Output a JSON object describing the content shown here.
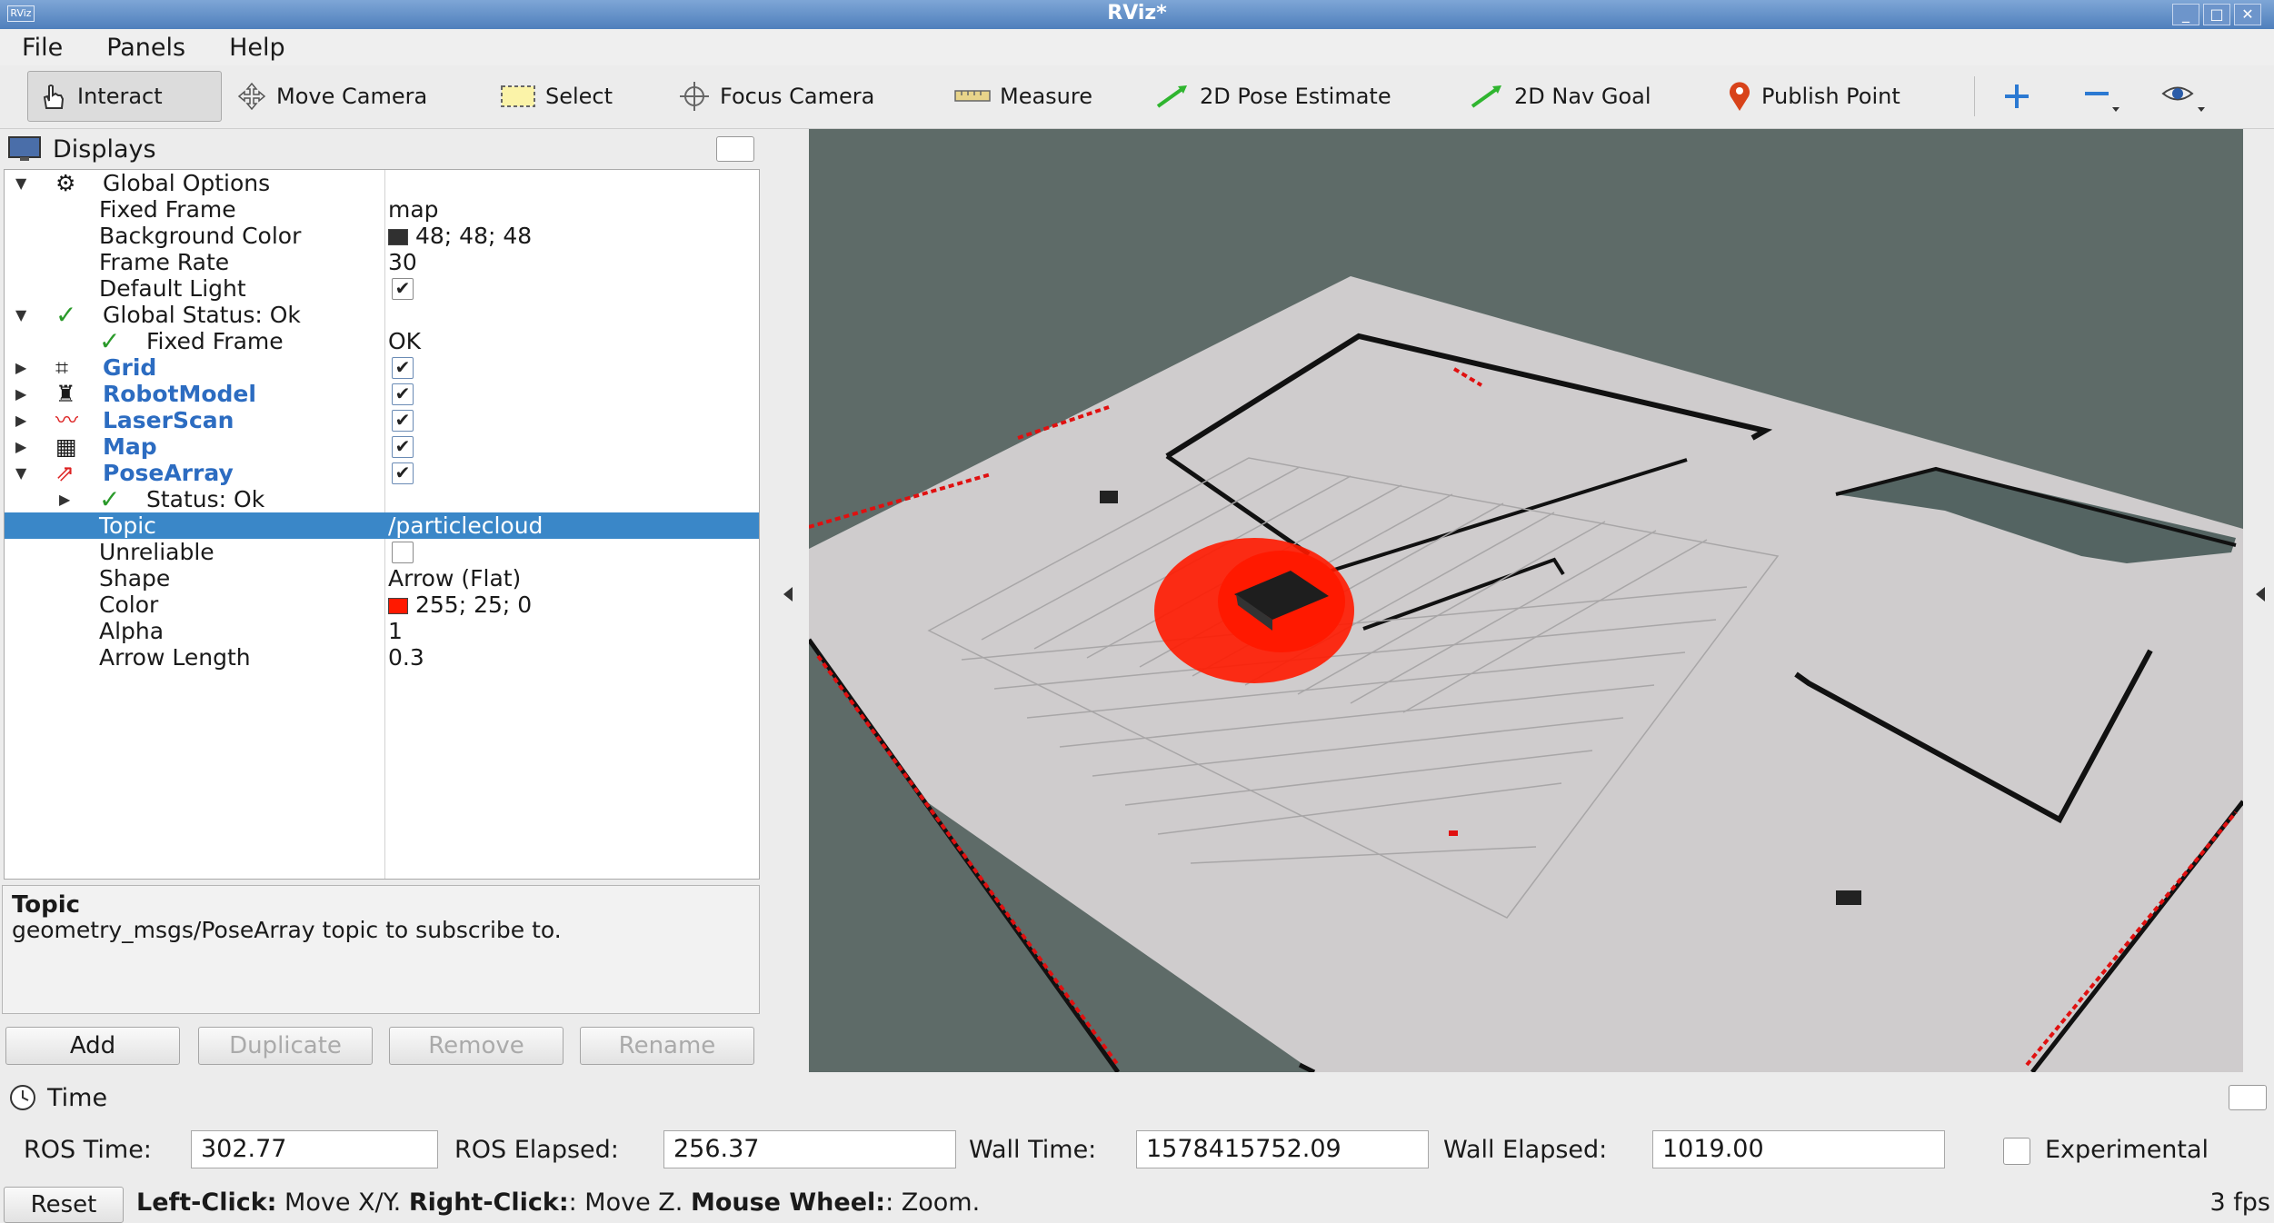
{
  "window": {
    "title": "RViz*",
    "app_icon_text": "RViz"
  },
  "menu": [
    "File",
    "Panels",
    "Help"
  ],
  "toolbar": {
    "interact": "Interact",
    "move_camera": "Move Camera",
    "select": "Select",
    "focus_camera": "Focus Camera",
    "measure": "Measure",
    "pose_estimate": "2D Pose Estimate",
    "nav_goal": "2D Nav Goal",
    "publish_point": "Publish Point"
  },
  "displays": {
    "title": "Displays",
    "global_options": "Global Options",
    "fixed_frame": {
      "label": "Fixed Frame",
      "value": "map"
    },
    "background_color": {
      "label": "Background Color",
      "value": "48; 48; 48",
      "color": "#303030"
    },
    "frame_rate": {
      "label": "Frame Rate",
      "value": "30"
    },
    "default_light": {
      "label": "Default Light",
      "checked": true
    },
    "global_status": "Global Status: Ok",
    "gs_fixed_frame": {
      "label": "Fixed Frame",
      "value": "OK"
    },
    "grid": "Grid",
    "robot_model": "RobotModel",
    "laser_scan": "LaserScan",
    "map": "Map",
    "pose_array": "PoseArray",
    "pa_status": "Status: Ok",
    "topic": {
      "label": "Topic",
      "value": "/particlecloud"
    },
    "unreliable": {
      "label": "Unreliable",
      "checked": false
    },
    "shape": {
      "label": "Shape",
      "value": "Arrow (Flat)"
    },
    "color": {
      "label": "Color",
      "value": "255; 25; 0",
      "color": "#ff1900"
    },
    "alpha": {
      "label": "Alpha",
      "value": "1"
    },
    "arrow_length": {
      "label": "Arrow Length",
      "value": "0.3"
    }
  },
  "description": {
    "title": "Topic",
    "text": "geometry_msgs/PoseArray topic to subscribe to."
  },
  "buttons": {
    "add": "Add",
    "duplicate": "Duplicate",
    "remove": "Remove",
    "rename": "Rename"
  },
  "time": {
    "title": "Time",
    "ros_time_label": "ROS Time:",
    "ros_time": "302.77",
    "ros_elapsed_label": "ROS Elapsed:",
    "ros_elapsed": "256.37",
    "wall_time_label": "Wall Time:",
    "wall_time": "1578415752.09",
    "wall_elapsed_label": "Wall Elapsed:",
    "wall_elapsed": "1019.00",
    "experimental": "Experimental",
    "reset": "Reset"
  },
  "status": {
    "left_click": "Left-Click:",
    "left_action": " Move X/Y. ",
    "right_click": "Right-Click:",
    "right_action": ": Move Z. ",
    "wheel": "Mouse Wheel:",
    "wheel_action": ": Zoom.",
    "fps": "3 fps"
  }
}
